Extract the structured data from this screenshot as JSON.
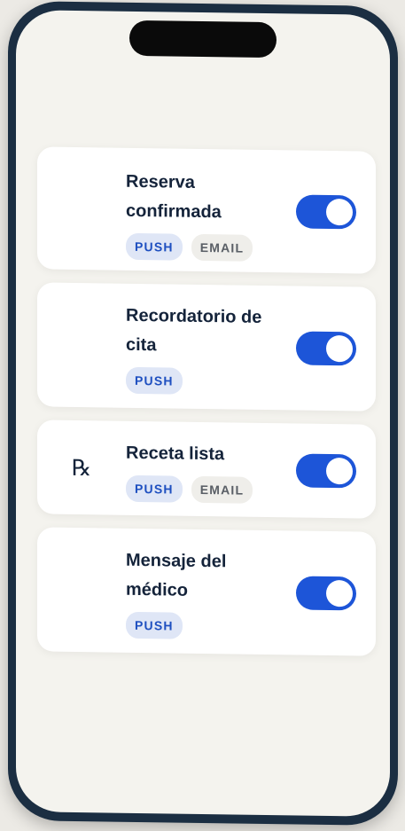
{
  "notifications": [
    {
      "title": "Reserva confirmada",
      "icon": "",
      "tags": [
        "PUSH",
        "EMAIL"
      ],
      "enabled": true
    },
    {
      "title": "Recordatorio de cita",
      "icon": "",
      "tags": [
        "PUSH"
      ],
      "enabled": true
    },
    {
      "title": "Receta lista",
      "icon": "℞",
      "tags": [
        "PUSH",
        "EMAIL"
      ],
      "enabled": true
    },
    {
      "title": "Mensaje del médico",
      "icon": "",
      "tags": [
        "PUSH"
      ],
      "enabled": true
    }
  ],
  "colors": {
    "accent": "#1d55d8",
    "push_badge_bg": "#dfe6f6",
    "email_badge_bg": "#efeeea",
    "screen_bg": "#f4f3ee",
    "frame": "#1b2e42"
  }
}
